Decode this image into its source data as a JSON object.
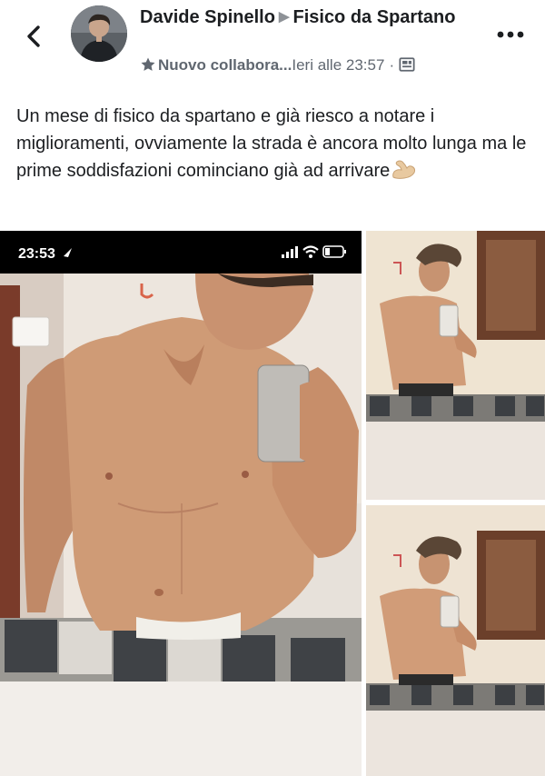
{
  "header": {
    "author": "Davide Spinello",
    "group": "Fisico da Spartano",
    "member_badge": "Nuovo collabora...",
    "timestamp": "Ieri alle 23:57",
    "separator": "·"
  },
  "post": {
    "text": "Un mese di fisico da spartano e già riesco a notare i miglioramenti, ovviamente la strada è ancora molto lunga ma le prime soddisfazioni cominciano già ad arrivare",
    "emoji": "flexed-biceps-emoji"
  },
  "photo_main": {
    "status_time": "23:53"
  },
  "icons": {
    "back": "chevron-left-icon",
    "more": "more-options-icon",
    "star": "star-icon",
    "photo": "photo-icon"
  },
  "colors": {
    "text": "#1c1e21",
    "meta": "#606770"
  }
}
